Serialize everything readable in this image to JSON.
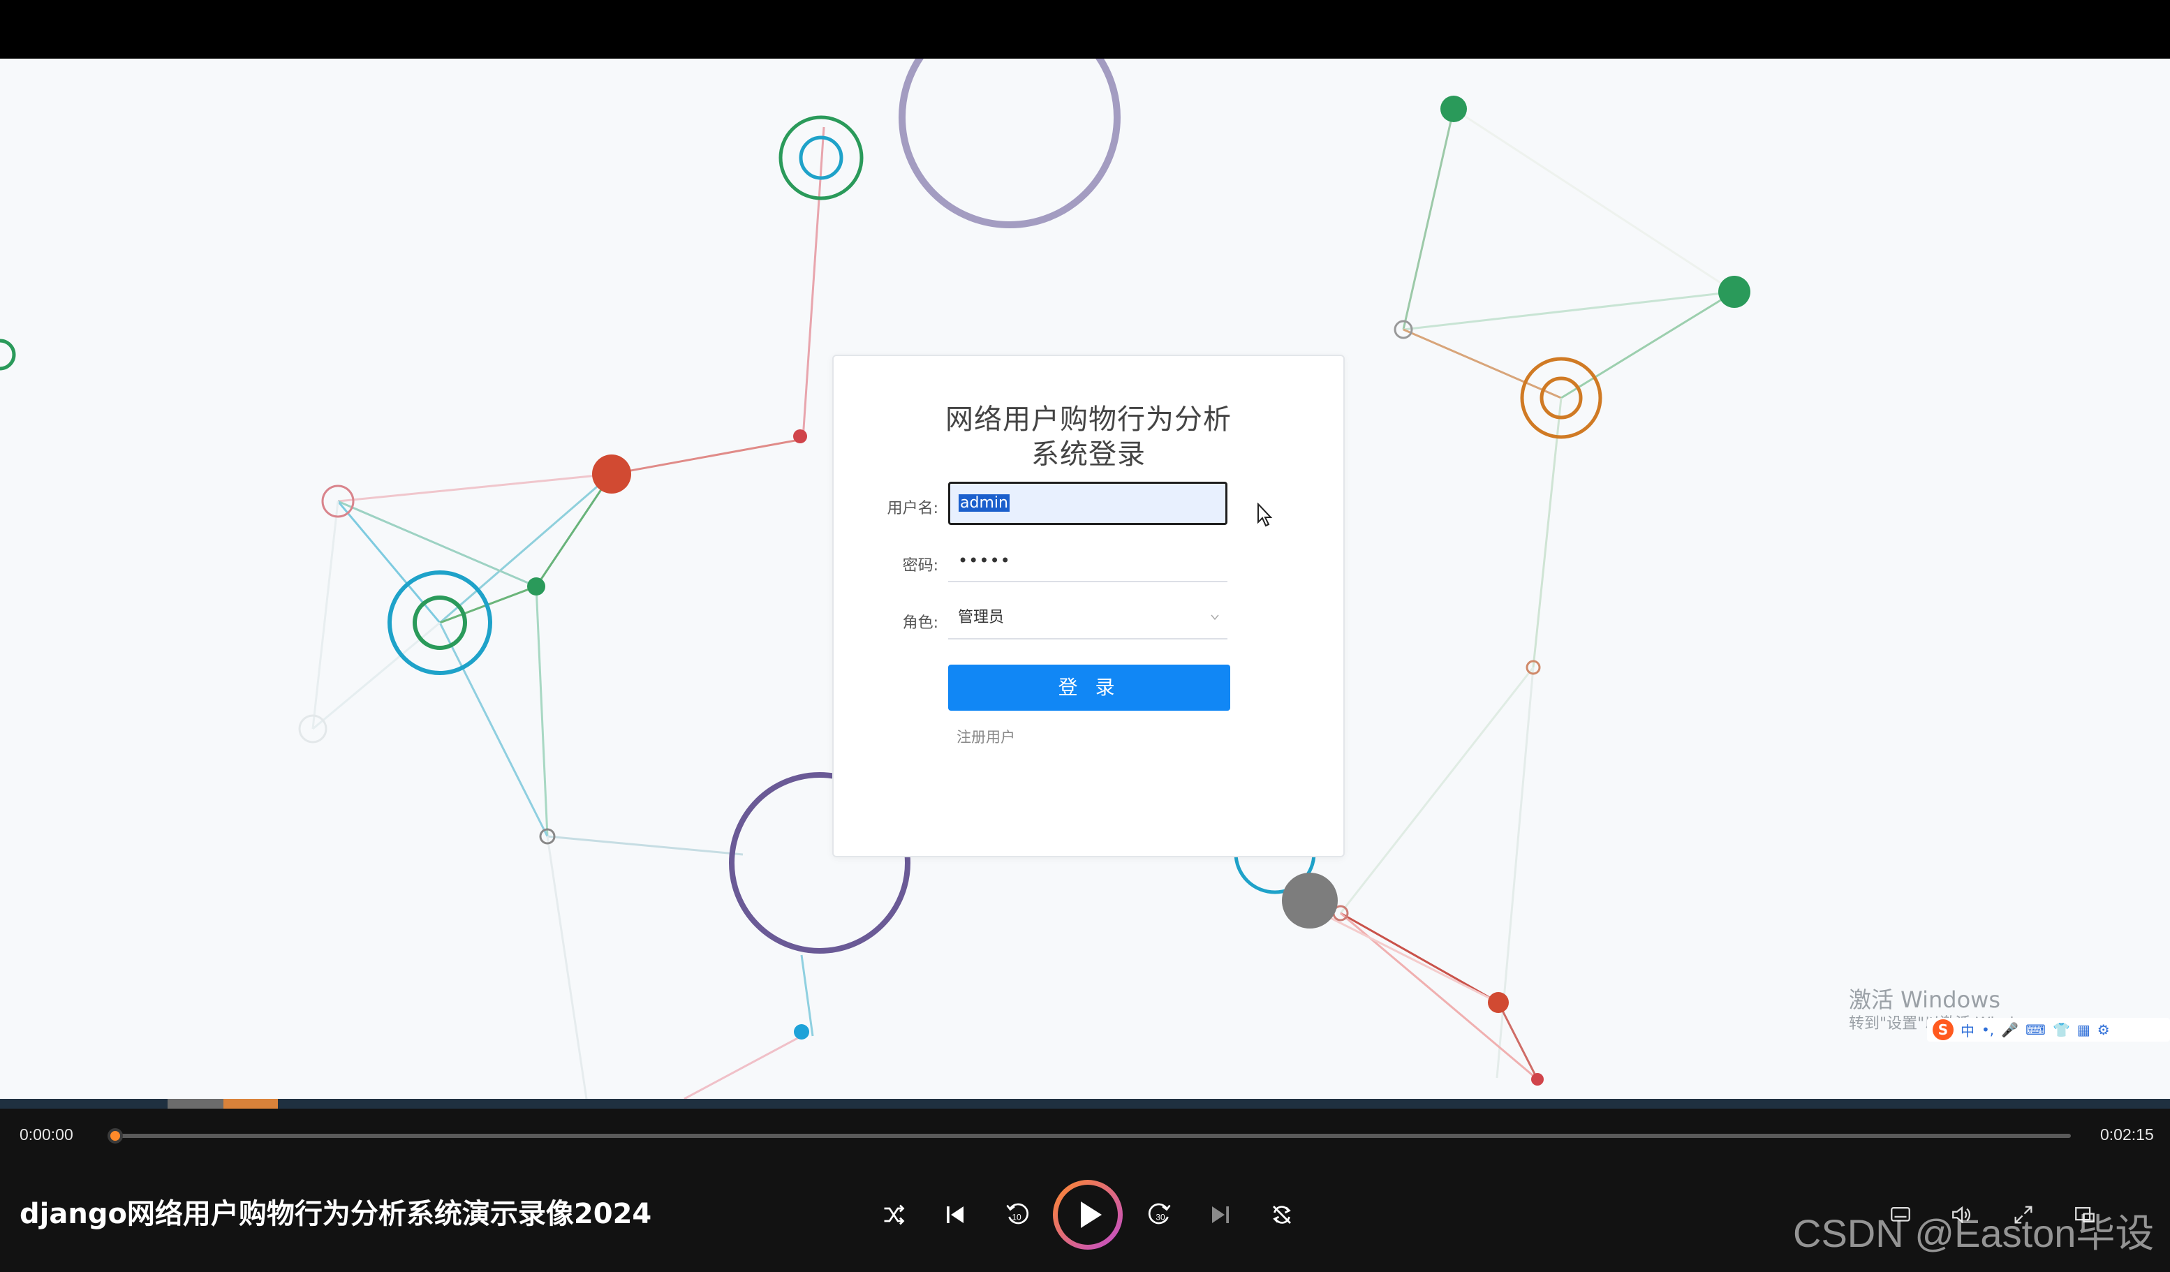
{
  "login": {
    "title_line1": "网络用户购物行为分析",
    "title_line2": "系统登录",
    "username_label": "用户名:",
    "username_value": "admin",
    "password_label": "密码:",
    "password_value": "•••••",
    "role_label": "角色:",
    "role_value": "管理员",
    "login_button": "登 录",
    "register_link": "注册用户"
  },
  "watermark": {
    "title": "激活 Windows",
    "subtitle": "转到\"设置\"以激活 Windows。"
  },
  "ime": {
    "mode": "中"
  },
  "player": {
    "time_current": "0:00:00",
    "time_total": "0:02:15",
    "progress": 0.0,
    "video_title": "django网络用户购物行为分析系统演示录像2024",
    "controls": [
      "shuffle-icon",
      "previous-icon",
      "rewind-10-icon",
      "play-icon",
      "forward-30-icon",
      "next-icon",
      "repeat-icon",
      "subtitles-icon",
      "volume-icon",
      "fullscreen-icon",
      "miniplayer-icon"
    ]
  },
  "csdn_watermark": "CSDN @Easton毕设",
  "colors": {
    "accent_blue": "#1187f5",
    "player_bg": "#121212",
    "play_gradient_start": "#ff8a2a",
    "play_gradient_end": "#c04bd0"
  }
}
